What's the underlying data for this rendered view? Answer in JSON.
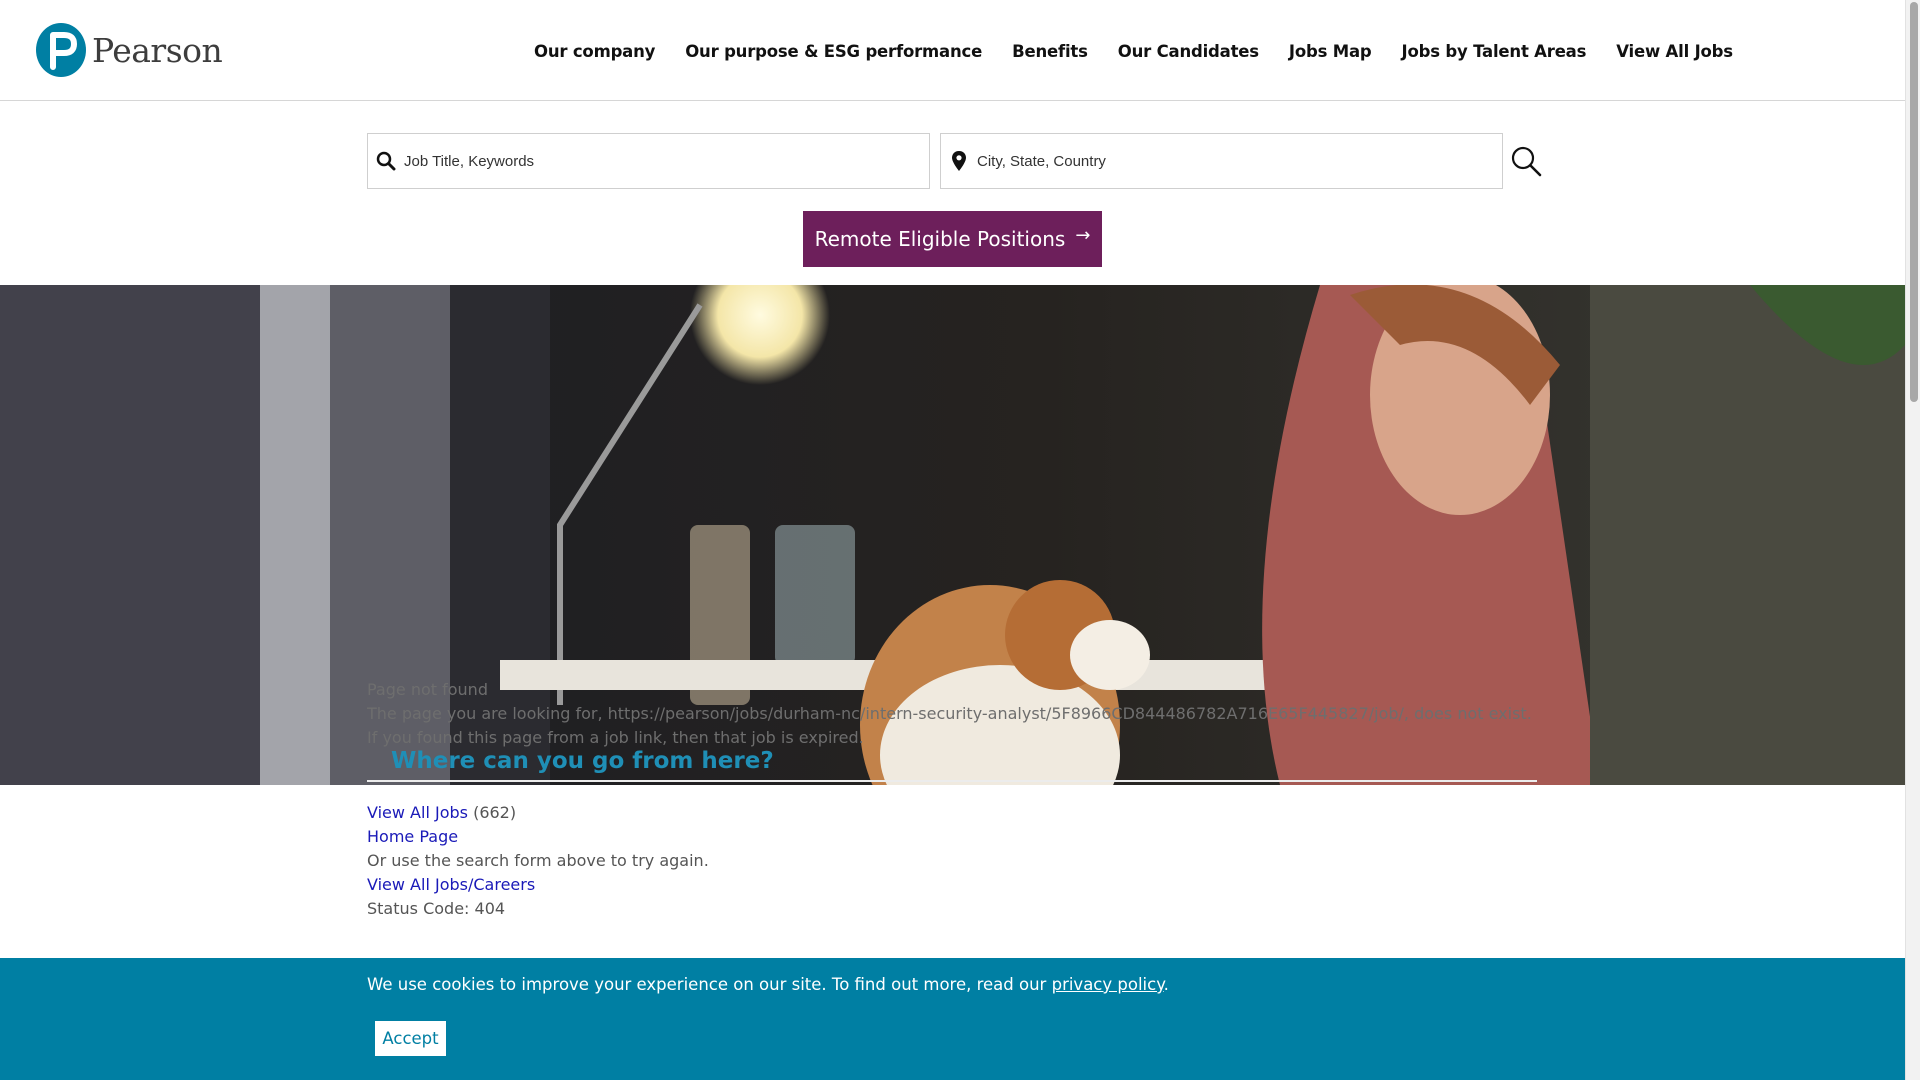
{
  "brand": {
    "name": "Pearson",
    "icon": "pearson-logo-icon",
    "color": "#007fa3"
  },
  "nav": [
    {
      "label": "Our company"
    },
    {
      "label": "Our purpose & ESG performance"
    },
    {
      "label": "Benefits"
    },
    {
      "label": "Our Candidates"
    },
    {
      "label": "Jobs Map"
    },
    {
      "label": "Jobs by Talent Areas"
    },
    {
      "label": "View All Jobs"
    }
  ],
  "search": {
    "keyword_placeholder": "Job Title, Keywords",
    "location_placeholder": "City, State, Country",
    "keyword_icon": "search-icon",
    "location_icon": "map-pin-icon",
    "submit_icon": "search-icon"
  },
  "remote_button": {
    "label": "Remote Eligible Positions",
    "arrow": "→",
    "color": "#6d1f5b"
  },
  "hero": {
    "line1": "Page not found",
    "line2": "The page you are looking for, https://pearson/jobs/durham-nc/intern-security-analyst/5F8966CD844486782A716E65F445827/job/, does not exist.",
    "line3": "If you found this page from a job link, then that job is expired.",
    "heading": "Where can you go from here?"
  },
  "links": {
    "view_all_jobs": "View All Jobs",
    "view_all_jobs_count": "(662)",
    "home_page": "Home Page",
    "retry_text": "Or use the search form above to try again.",
    "careers": "View All Jobs/Careers",
    "status": "Status Code: 404"
  },
  "cookie": {
    "text": "We use cookies to improve your experience on our site. To find out more, read our",
    "link": "privacy policy",
    "period": ".",
    "accept": "Accept",
    "color": "#007fa3"
  }
}
